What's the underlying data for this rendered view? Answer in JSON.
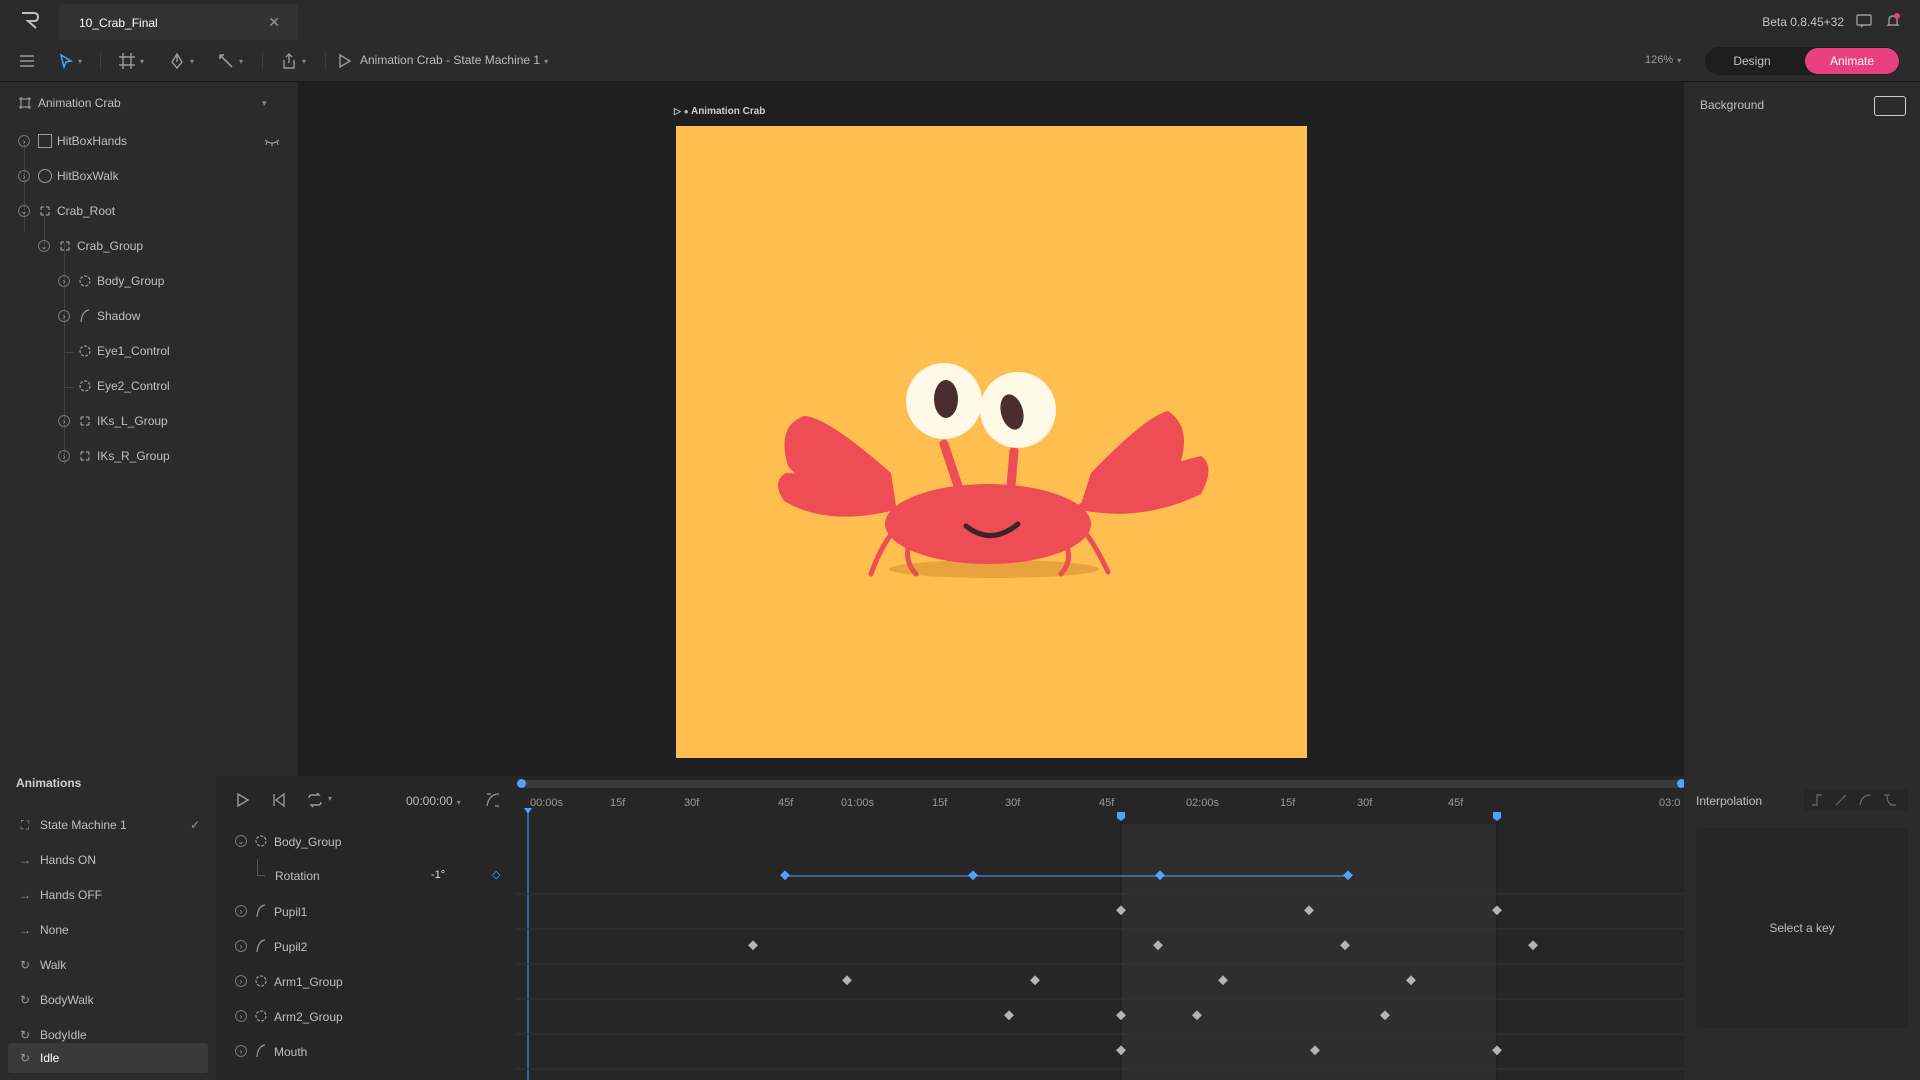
{
  "window": {
    "tab_title": "10_Crab_Final",
    "version": "Beta 0.8.45+32"
  },
  "toolbar": {
    "state_machine_title": "Animation Crab - State Machine 1",
    "zoom": "126%",
    "mode_design": "Design",
    "mode_animate": "Animate"
  },
  "hierarchy": {
    "artboard": "Animation Crab",
    "items": [
      {
        "label": "HitBoxHands"
      },
      {
        "label": "HitBoxWalk"
      },
      {
        "label": "Crab_Root"
      },
      {
        "label": "Crab_Group"
      },
      {
        "label": "Body_Group"
      },
      {
        "label": "Shadow"
      },
      {
        "label": "Eye1_Control"
      },
      {
        "label": "Eye2_Control"
      },
      {
        "label": "IKs_L_Group"
      },
      {
        "label": "IKs_R_Group"
      }
    ]
  },
  "stage": {
    "artboard_label": "Animation Crab",
    "background_color": "#ffbe50"
  },
  "properties": {
    "background_label": "Background"
  },
  "animations": {
    "header": "Animations",
    "items": [
      {
        "label": "State Machine 1",
        "kind": "state-machine"
      },
      {
        "label": "Hands ON",
        "kind": "transition"
      },
      {
        "label": "Hands OFF",
        "kind": "transition"
      },
      {
        "label": "None",
        "kind": "transition"
      },
      {
        "label": "Walk",
        "kind": "loop"
      },
      {
        "label": "BodyWalk",
        "kind": "loop"
      },
      {
        "label": "BodyIdle",
        "kind": "loop"
      },
      {
        "label": "Idle",
        "kind": "loop"
      }
    ]
  },
  "timeline": {
    "time": "00:00:00",
    "ruler_labels": [
      "00:00s",
      "15f",
      "30f",
      "45f",
      "01:00s",
      "15f",
      "30f",
      "45f",
      "02:00s",
      "15f",
      "30f",
      "45f",
      "03:0"
    ],
    "rows": [
      {
        "label": "Body_Group"
      },
      {
        "label": "Rotation",
        "value": "-1°"
      },
      {
        "label": "Pupil1"
      },
      {
        "label": "Pupil2"
      },
      {
        "label": "Arm1_Group"
      },
      {
        "label": "Arm2_Group"
      },
      {
        "label": "Mouth"
      }
    ]
  },
  "interpolation": {
    "label": "Interpolation",
    "empty_state": "Select a key"
  },
  "colors": {
    "accent": "#e8407f",
    "key_selected": "#4fa3ff",
    "crab": "#ee4d55"
  }
}
